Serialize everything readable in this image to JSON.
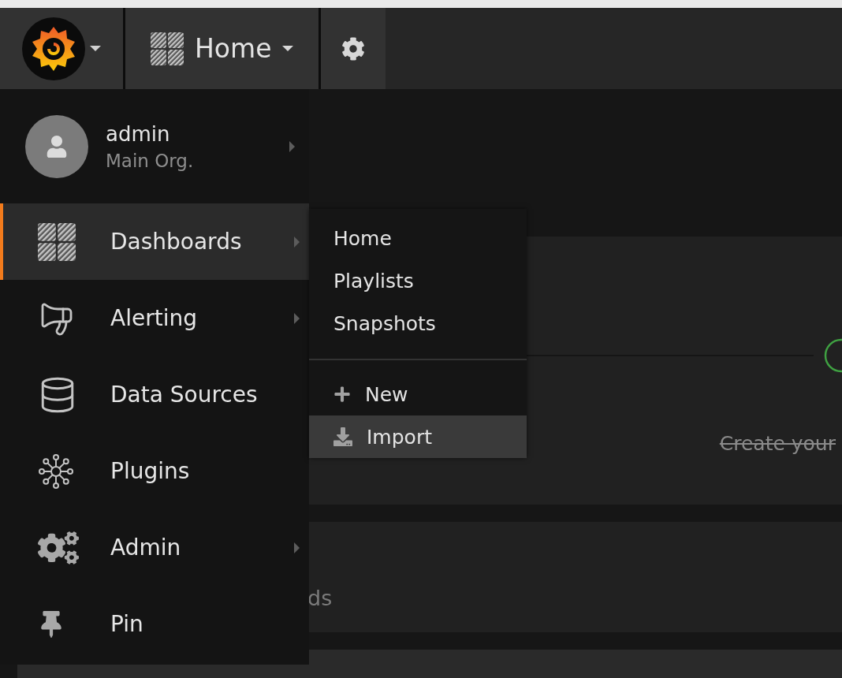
{
  "top_bar": {
    "dashboard_title": "Home"
  },
  "user": {
    "name": "admin",
    "org": "Main Org.",
    "submenu": true
  },
  "menu": [
    {
      "label": "Dashboards",
      "selected": true,
      "submenu": true
    },
    {
      "label": "Alerting",
      "selected": false,
      "submenu": true
    },
    {
      "label": "Data Sources",
      "selected": false,
      "submenu": false
    },
    {
      "label": "Plugins",
      "selected": false,
      "submenu": false
    },
    {
      "label": "Admin",
      "selected": false,
      "submenu": true
    },
    {
      "label": "Pin",
      "selected": false,
      "submenu": false
    }
  ],
  "submenu": {
    "links": [
      {
        "label": "Home",
        "selected": false
      },
      {
        "label": "Playlists",
        "selected": false
      },
      {
        "label": "Snapshots",
        "selected": false
      }
    ],
    "actions": [
      {
        "label": "New",
        "selected": false
      },
      {
        "label": "Import",
        "selected": true
      }
    ]
  },
  "backdrop": {
    "note": "Create your",
    "heading_fragment": "ds"
  }
}
